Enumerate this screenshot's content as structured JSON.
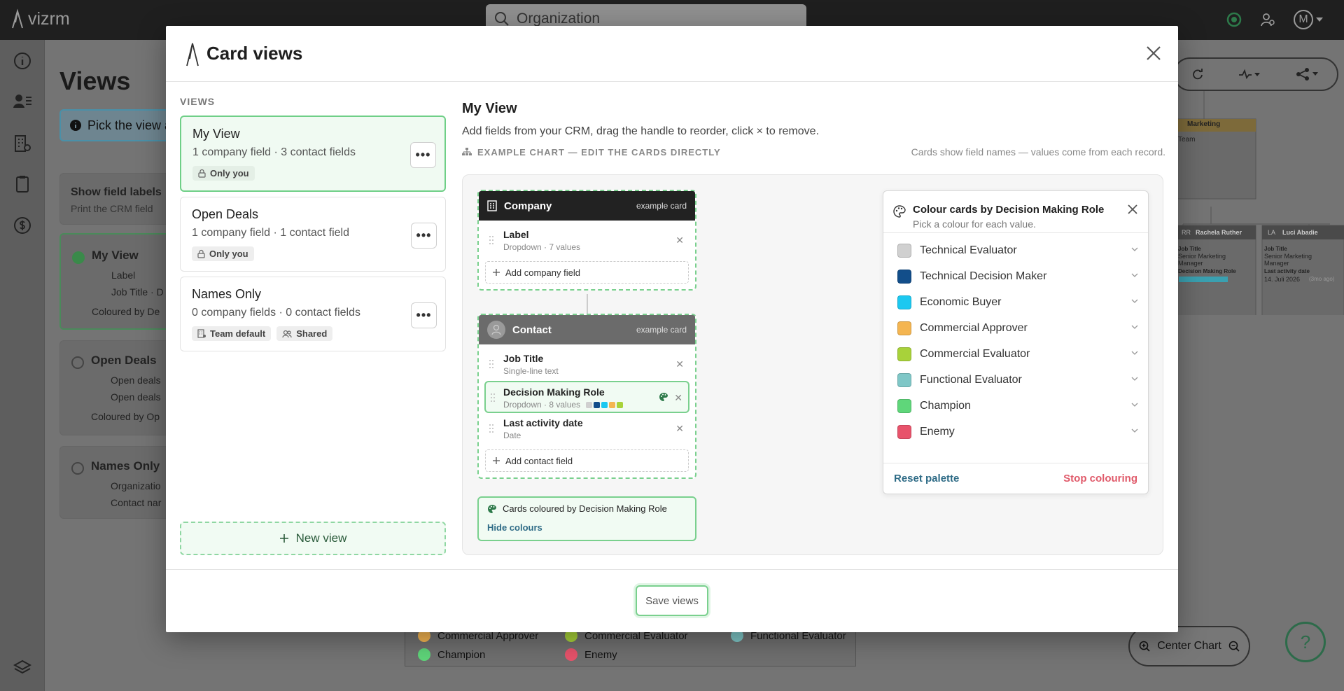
{
  "app": {
    "logo_text": "vizrm"
  },
  "topbar": {
    "search_placeholder": "Organization",
    "avatar_letter": "M"
  },
  "background": {
    "page_title": "Views",
    "pick_text": "Pick the view a",
    "show_labels_title": "Show field labels",
    "show_labels_sub": "Print the CRM field",
    "views": [
      {
        "name": "My View",
        "lines": [
          "Label",
          "Job Title · D"
        ],
        "coloured": "Coloured by De"
      },
      {
        "name": "Open Deals",
        "lines": [
          "Open deals",
          "Open deals"
        ],
        "coloured": "Coloured by Op"
      },
      {
        "name": "Names Only",
        "lines": [
          "Organizatio",
          "Contact nar"
        ]
      }
    ],
    "chart": {
      "team_title": "Marketing",
      "team_sub": "Team",
      "person1": {
        "initials": "RR",
        "name": "Rachela Ruther",
        "field1": "Job Title",
        "value1": "Senior Marketing Manager",
        "field2": "Decision Making Role"
      },
      "person2": {
        "initials": "LA",
        "name": "Luci Abadie",
        "field1": "Job Title",
        "value1": "Senior Marketing Manager",
        "field2": "Last activity date",
        "value2": "14. Juli 2026",
        "ago": "(3mo ago)"
      }
    },
    "legend": [
      {
        "label": "Commercial Approver",
        "color": "#f4b551"
      },
      {
        "label": "Commercial Evaluator",
        "color": "#a8d23a"
      },
      {
        "label": "Functional Evaluator",
        "color": "#7fc7c7"
      },
      {
        "label": "Champion",
        "color": "#5fd67a"
      },
      {
        "label": "Enemy",
        "color": "#e8536b"
      }
    ],
    "center_chart_label": "Center Chart",
    "help_label": "?"
  },
  "modal": {
    "title": "Card views",
    "views_label": "VIEWS",
    "views": [
      {
        "name": "My View",
        "summary": "1 company field · 3 contact fields",
        "tags": [
          "Only you"
        ]
      },
      {
        "name": "Open Deals",
        "summary": "1 company field · 1 contact field",
        "tags": [
          "Only you"
        ]
      },
      {
        "name": "Names Only",
        "summary": "0 company fields · 0 contact fields",
        "tags": [
          "Team default",
          "Shared"
        ]
      }
    ],
    "more_label": "•••",
    "new_view_label": "New view",
    "content": {
      "title": "My View",
      "description": "Add fields from your CRM, drag the handle to reorder, click × to remove.",
      "example_label": "EXAMPLE CHART — EDIT THE CARDS DIRECTLY",
      "note": "Cards show field names — values come from each record."
    },
    "company_card": {
      "title": "Company",
      "badge": "example card",
      "fields": [
        {
          "name": "Label",
          "type": "Dropdown · 7 values"
        }
      ],
      "add_label": "Add company field"
    },
    "contact_card": {
      "title": "Contact",
      "badge": "example card",
      "fields": [
        {
          "name": "Job Title",
          "type": "Single-line text"
        },
        {
          "name": "Decision Making Role",
          "type": "Dropdown · 8 values"
        },
        {
          "name": "Last activity date",
          "type": "Date"
        }
      ],
      "role_swatches": [
        "#d0d0d0",
        "#124e8a",
        "#1cc8f0",
        "#f4b551",
        "#a8d23a"
      ],
      "add_label": "Add contact field"
    },
    "coloured_box": {
      "text": "Cards coloured by Decision Making Role",
      "hide_label": "Hide colours"
    },
    "palette": {
      "title": "Colour cards by Decision Making Role",
      "subtitle": "Pick a colour for each value.",
      "items": [
        {
          "label": "Technical Evaluator",
          "color": "#d0d0d0"
        },
        {
          "label": "Technical Decision Maker",
          "color": "#124e8a"
        },
        {
          "label": "Economic Buyer",
          "color": "#1cc8f0"
        },
        {
          "label": "Commercial Approver",
          "color": "#f4b551"
        },
        {
          "label": "Commercial Evaluator",
          "color": "#a8d23a"
        },
        {
          "label": "Functional Evaluator",
          "color": "#7fc7c7"
        },
        {
          "label": "Champion",
          "color": "#5fd67a"
        },
        {
          "label": "Enemy",
          "color": "#e8536b"
        }
      ],
      "reset_label": "Reset palette",
      "stop_label": "Stop colouring"
    },
    "save_label": "Save views"
  },
  "colors": {
    "accent_green": "#7ad08e",
    "link_blue": "#2e6b86",
    "danger": "#e05a6a",
    "company_header": "#222222",
    "contact_header": "#6b6b6b"
  }
}
